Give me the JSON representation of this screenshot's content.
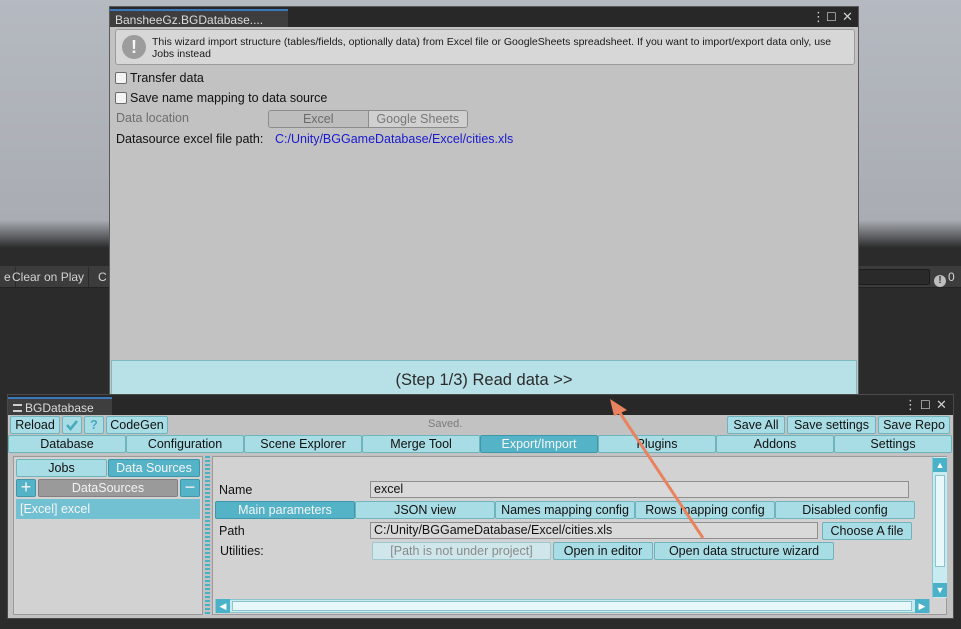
{
  "console": {
    "items": [
      "e",
      "Clear on Play",
      "C"
    ],
    "badge": "0"
  },
  "wizard": {
    "title": "BansheeGz.BGDatabase....",
    "info": "This wizard import structure (tables/fields, optionally data) from Excel file or GoogleSheets spreadsheet. If you want to import/export data only, use Jobs instead",
    "transfer_data": "Transfer data",
    "save_mapping": "Save name mapping to data source",
    "data_location_label": "Data location",
    "location_options": [
      "Excel",
      "Google Sheets"
    ],
    "location_selected": "Excel",
    "path_label": "Datasource excel file path:",
    "path_value": "C:/Unity/BGGameDatabase/Excel/cities.xls",
    "step_button": "(Step 1/3) Read data >>"
  },
  "bgdb": {
    "title": "BGDatabase",
    "toolbar": {
      "reload": "Reload",
      "codegen": "CodeGen",
      "status": "Saved.",
      "save_all": "Save All",
      "save_settings": "Save settings",
      "save_repo": "Save Repo"
    },
    "tabs": [
      "Database",
      "Configuration",
      "Scene Explorer",
      "Merge Tool",
      "Export/Import",
      "Plugins",
      "Addons",
      "Settings"
    ],
    "active_tab": "Export/Import",
    "left": {
      "subtabs": [
        "Jobs",
        "Data Sources"
      ],
      "list_header": "DataSources",
      "items": [
        "[Excel] excel"
      ]
    },
    "right": {
      "name_label": "Name",
      "name_value": "excel",
      "subtabs": [
        "Main parameters",
        "JSON view",
        "Names mapping config",
        "Rows mapping config",
        "Disabled config"
      ],
      "path_label": "Path",
      "path_value": "C:/Unity/BGGameDatabase/Excel/cities.xls",
      "choose_file": "Choose A file",
      "utilities_label": "Utilities:",
      "not_under_project": "[Path is not under project]",
      "open_editor": "Open in editor",
      "open_wizard": "Open data structure wizard"
    }
  },
  "colors": {
    "accent": "#55b3c8",
    "step_button": "#b8e1e7",
    "annotation_arrow": "#e8825f"
  }
}
